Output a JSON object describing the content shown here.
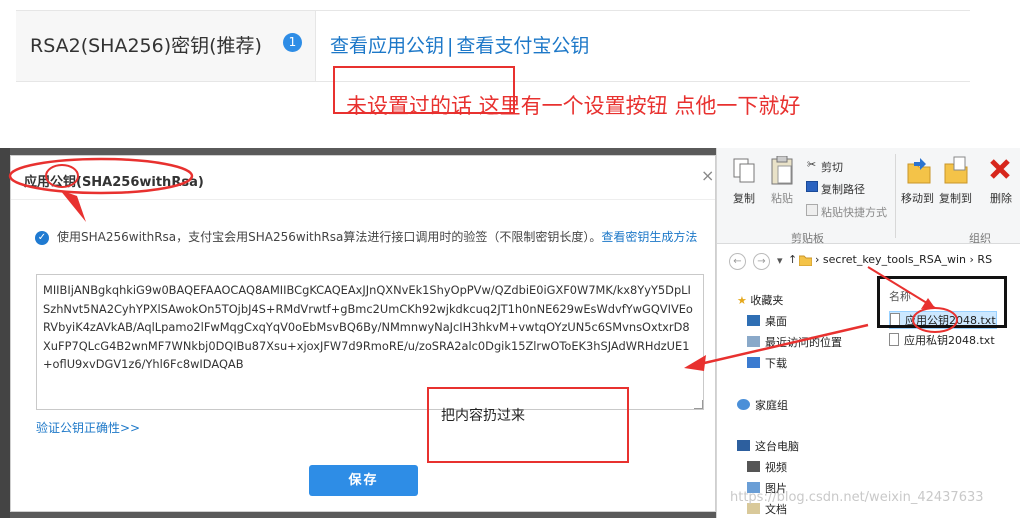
{
  "top": {
    "label": "RSA2(SHA256)密钥(推荐)",
    "info_badge": "1",
    "link_view_app_key": "查看应用公钥",
    "link_separator": "|",
    "link_view_alipay_key": "查看支付宝公钥",
    "annotation": "未设置过的话 这里有一个设置按钮 点他一下就好"
  },
  "modal": {
    "title": "应用公钥(SHA256withRsa)",
    "close": "×",
    "notice_text": "使用SHA256withRsa，支付宝会用SHA256withRsa算法进行接口调用时的验签（不限制密钥长度）。",
    "notice_link": "查看密钥生成方法",
    "key_value": "MIIBIjANBgkqhkiG9w0BAQEFAAOCAQ8AMIIBCgKCAQEAxJJnQXNvEk1ShyOpPVw/QZdbiE0iGXF0W7MK/kx8YyY5DpLISzhNvt5NA2CyhYPXlSAwokOn5TOjbJ4S+RMdVrwtf+gBmc2UmCKh92wjkdkcuq2JT1h0nNE629wEsWdvfYwGQVIVEoRVbyiK4zAVkAB/AqlLpamo2lFwMqgCxqYqV0oEbMsvBQ6By/NMmnwyNaJcIH3hkvM+vwtqOYzUN5c6SMvnsOxtxrD8XuFP7QLcG4B2wnMF7WNkbj0DQIBu87Xsu+xjoxJFW7d9RmoRE/u/zoSRA2alc0Dgik15ZlrwOToEK3hSJAdWRHdzUE1+oflU9xvDGV1z6/Yhl6Fc8wIDAQAB",
    "verify_link": "验证公钥正确性>>",
    "save_button": "保存",
    "annotation": "把内容扔过来"
  },
  "explorer": {
    "ribbon": {
      "copy": "复制",
      "paste": "粘贴",
      "cut": "剪切",
      "copy_path": "复制路径",
      "paste_shortcut": "粘贴快捷方式",
      "move_to": "移动到",
      "copy_to": "复制到",
      "delete": "删除",
      "group_clipboard": "剪贴板",
      "group_organize": "组织"
    },
    "address": {
      "path": "secret_key_tools_RSA_win",
      "path_next": "RS"
    },
    "nav": [
      {
        "label": "收藏夹",
        "icon": "star-icon"
      },
      {
        "label": "桌面",
        "icon": "desktop-icon"
      },
      {
        "label": "最近访问的位置",
        "icon": "recent-icon"
      },
      {
        "label": "下载",
        "icon": "download-icon"
      },
      {
        "label": "家庭组",
        "icon": "homegroup-icon"
      },
      {
        "label": "这台电脑",
        "icon": "computer-icon"
      },
      {
        "label": "视频",
        "icon": "video-icon"
      },
      {
        "label": "图片",
        "icon": "picture-icon"
      },
      {
        "label": "文档",
        "icon": "document-icon"
      }
    ],
    "column_name": "名称",
    "files": [
      {
        "name": "应用公钥2048.txt",
        "selected": true
      },
      {
        "name": "应用私钥2048.txt",
        "selected": false
      }
    ]
  },
  "watermark": "https://blog.csdn.net/weixin_42437633",
  "colors": {
    "link_blue": "#1d78c8",
    "primary_button": "#2e8de6",
    "annotation_red": "#e8312f"
  }
}
